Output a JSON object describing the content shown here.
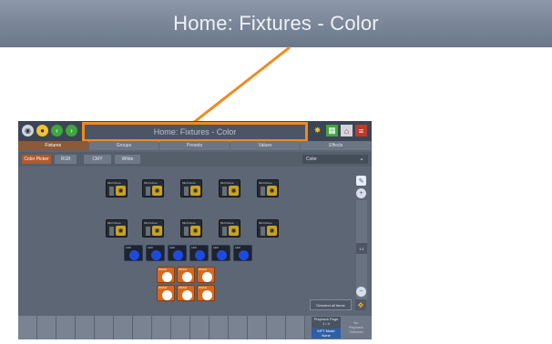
{
  "banner": {
    "title": "Home: Fixtures - Color"
  },
  "app": {
    "title": "Home: Fixtures - Color",
    "tabs": [
      "Fixtures",
      "Groups",
      "Presets",
      "Values",
      "Effects"
    ],
    "sub_tabs": [
      "Color Picker",
      "RGB",
      "CMY",
      "White"
    ],
    "dropdown_value": "Color",
    "fixture_rows": {
      "row1_labels": [
        "MH Fixture",
        "MH Fixture",
        "MH Fixture",
        "MH Fixture",
        "MH Fixture"
      ],
      "row2_labels": [
        "MH Fixture",
        "MH Fixture",
        "MH Fixture",
        "MH Fixture",
        "MH Fixture"
      ],
      "led_labels": [
        "LED",
        "LED",
        "LED",
        "LED",
        "LED",
        "LED"
      ],
      "wash_labels": [
        "WASH",
        "WASH",
        "WASH",
        "WASH",
        "WASH",
        "WASH"
      ]
    },
    "slider_value": "1:1",
    "deselect_label": "Deselect all items",
    "playback": {
      "line1": "Playback Page",
      "line2": "1 / 4",
      "mft_line1": "MFT Mode",
      "mft_line2": "None"
    },
    "no_playback": {
      "line1": "No",
      "line2": "Playback",
      "line3": "Selected"
    }
  },
  "colors": {
    "highlight": "#f08a1f",
    "active_tab": "#8a5a3a",
    "led_blue": "#1f4ae0",
    "wash_orange": "#d46a1e"
  }
}
